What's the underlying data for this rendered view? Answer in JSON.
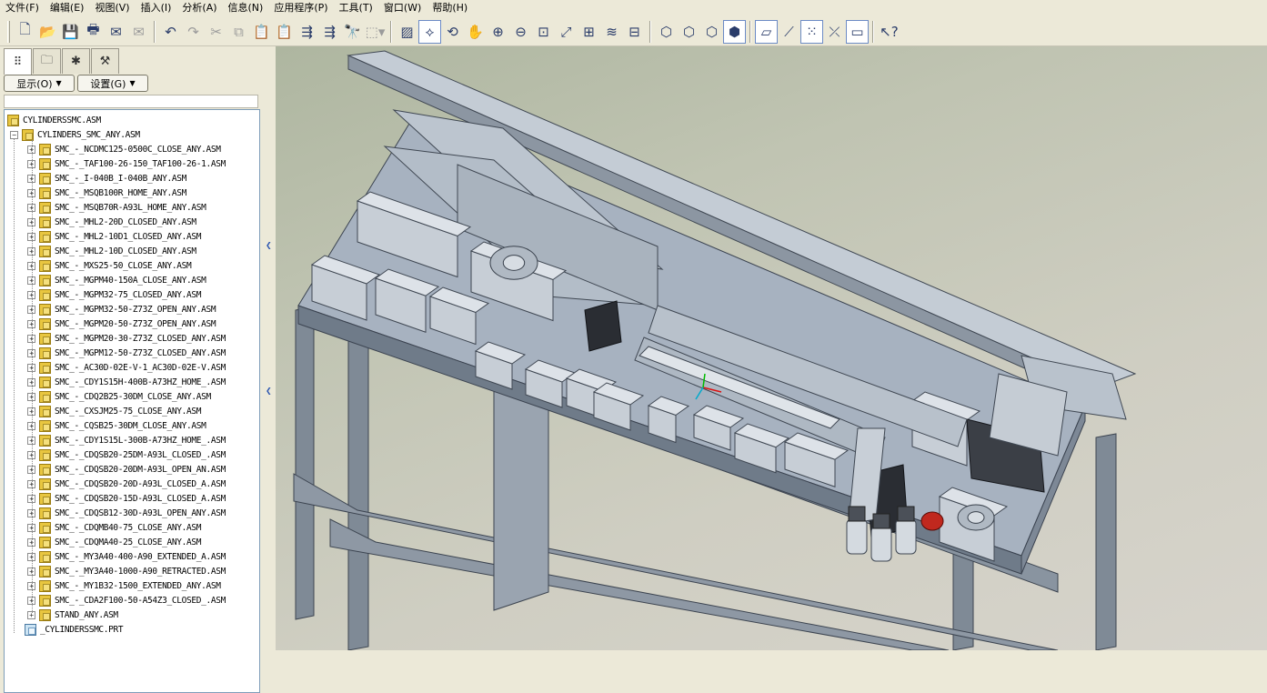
{
  "menubar": {
    "items": [
      "文件(F)",
      "编辑(E)",
      "视图(V)",
      "插入(I)",
      "分析(A)",
      "信息(N)",
      "应用程序(P)",
      "工具(T)",
      "窗口(W)",
      "帮助(H)"
    ]
  },
  "toolbar": {
    "buttons": [
      "new-icon",
      "open-icon",
      "save-icon",
      "print-icon",
      "email-icon",
      "email-attach-icon",
      "undo-icon",
      "redo-icon",
      "cut-icon",
      "copy-icon",
      "paste-icon",
      "paste-special-icon",
      "regenerate-icon",
      "regen-manager-icon",
      "find-icon",
      "select-box-icon",
      "repaint-icon",
      "spin-center-icon",
      "orient-icon",
      "pan-icon",
      "zoom-in-icon",
      "zoom-out-icon",
      "refit-icon",
      "reorient-icon",
      "saved-views-icon",
      "layers-icon",
      "view-manager-icon",
      "wireframe-icon",
      "hidden-line-icon",
      "no-hidden-icon",
      "shading-icon",
      "datum-planes-icon",
      "datum-axes-icon",
      "datum-points-icon",
      "coord-sys-icon",
      "annotations-icon",
      "whats-this-icon"
    ]
  },
  "panel": {
    "tabs": [
      "model-tree-tab-icon",
      "folder-browser-tab-icon",
      "favorites-tab-icon",
      "connections-tab-icon"
    ],
    "show_label": "显示(O)",
    "settings_label": "设置(G)"
  },
  "tree": {
    "root": "CYLINDERSSMC.ASM",
    "sub": "CYLINDERS_SMC_ANY.ASM",
    "items": [
      "SMC_-_NCDMC125-0500C_CLOSE_ANY.ASM",
      "SMC_-_TAF100-26-150_TAF100-26-1.ASM",
      "SMC_-_I-040B_I-040B_ANY.ASM",
      "SMC_-_MSQB100R_HOME_ANY.ASM",
      "SMC_-_MSQB70R-A93L_HOME_ANY.ASM",
      "SMC_-_MHL2-20D_CLOSED_ANY.ASM",
      "SMC_-_MHL2-10D1_CLOSED_ANY.ASM",
      "SMC_-_MHL2-10D_CLOSED_ANY.ASM",
      "SMC_-_MXS25-50_CLOSE_ANY.ASM",
      "SMC_-_MGPM40-150A_CLOSE_ANY.ASM",
      "SMC_-_MGPM32-75_CLOSED_ANY.ASM",
      "SMC_-_MGPM32-50-Z73Z_OPEN_ANY.ASM",
      "SMC_-_MGPM20-50-Z73Z_OPEN_ANY.ASM",
      "SMC_-_MGPM20-30-Z73Z_CLOSED_ANY.ASM",
      "SMC_-_MGPM12-50-Z73Z_CLOSED_ANY.ASM",
      "SMC_-_AC30D-02E-V-1_AC30D-02E-V.ASM",
      "SMC_-_CDY1S15H-400B-A73HZ_HOME_.ASM",
      "SMC_-_CDQ2B25-30DM_CLOSE_ANY.ASM",
      "SMC_-_CXSJM25-75_CLOSE_ANY.ASM",
      "SMC_-_CQSB25-30DM_CLOSE_ANY.ASM",
      "SMC_-_CDY1S15L-300B-A73HZ_HOME_.ASM",
      "SMC_-_CDQSB20-25DM-A93L_CLOSED_.ASM",
      "SMC_-_CDQSB20-20DM-A93L_OPEN_AN.ASM",
      "SMC_-_CDQSB20-20D-A93L_CLOSED_A.ASM",
      "SMC_-_CDQSB20-15D-A93L_CLOSED_A.ASM",
      "SMC_-_CDQSB12-30D-A93L_OPEN_ANY.ASM",
      "SMC_-_CDQMB40-75_CLOSE_ANY.ASM",
      "SMC_-_CDQMA40-25_CLOSE_ANY.ASM",
      "SMC_-_MY3A40-400-A90_EXTENDED_A.ASM",
      "SMC_-_MY3A40-1000-A90_RETRACTED.ASM",
      "SMC_-_MY1B32-1500_EXTENDED_ANY.ASM",
      "SMC_-_CDA2F100-50-A54Z3_CLOSED_.ASM",
      "STAND_ANY.ASM"
    ],
    "part": "_CYLINDERSSMC.PRT"
  }
}
